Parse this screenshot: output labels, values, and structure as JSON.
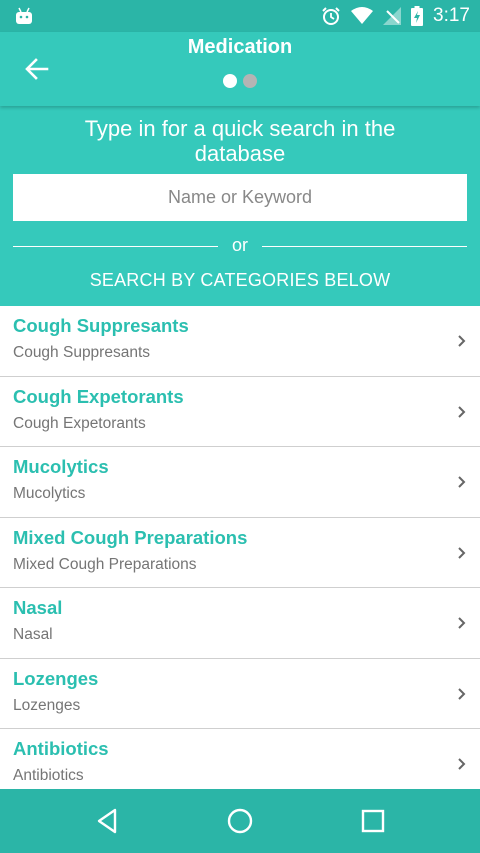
{
  "status_bar": {
    "time": "3:17",
    "icons": [
      "android-icon",
      "alarm-icon",
      "wifi-icon",
      "signal-icon",
      "battery-charging-icon"
    ]
  },
  "header": {
    "title": "Medication",
    "back_icon": "arrow-left-icon",
    "page_dots": {
      "count": 2,
      "active_index": 0
    }
  },
  "search": {
    "prompt": "Type in for a quick search in the database",
    "placeholder": "Name or Keyword",
    "value": "",
    "divider_label": "or",
    "categories_heading": "SEARCH BY CATEGORIES BELOW"
  },
  "categories": [
    {
      "title": "Cough Suppresants",
      "subtitle": "Cough Suppresants"
    },
    {
      "title": "Cough Expetorants",
      "subtitle": "Cough Expetorants"
    },
    {
      "title": "Mucolytics",
      "subtitle": "Mucolytics"
    },
    {
      "title": "Mixed Cough Preparations",
      "subtitle": "Mixed Cough Preparations"
    },
    {
      "title": "Nasal",
      "subtitle": "Nasal"
    },
    {
      "title": "Lozenges",
      "subtitle": "Lozenges"
    },
    {
      "title": "Antibiotics",
      "subtitle": "Antibiotics"
    }
  ],
  "nav_bar": {
    "buttons": [
      "back-triangle-icon",
      "home-circle-icon",
      "recents-square-icon"
    ]
  },
  "colors": {
    "accent": "#35c9bb",
    "status_bar": "#2bb5a7",
    "item_title": "#2bbfb0",
    "item_subtitle": "#757575"
  }
}
